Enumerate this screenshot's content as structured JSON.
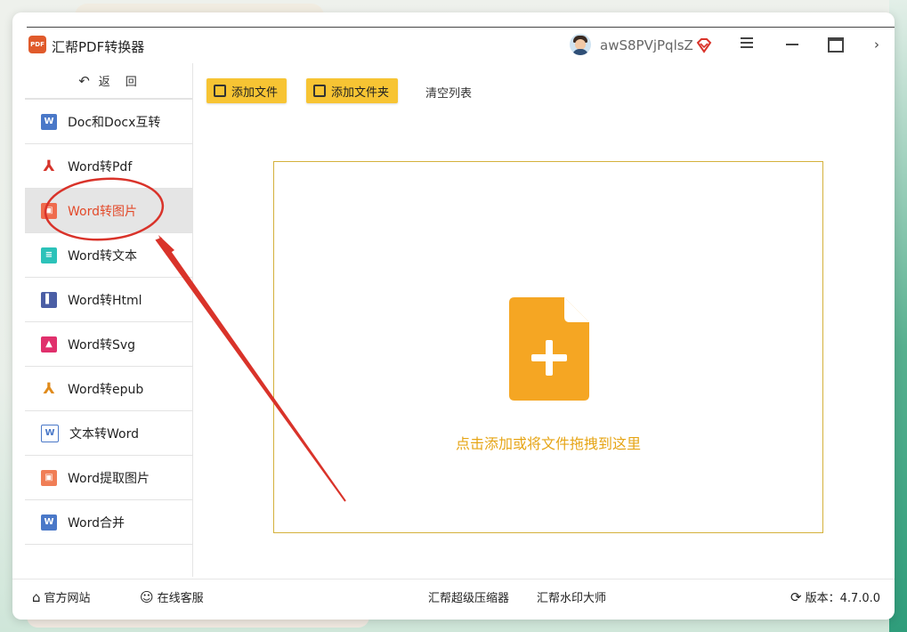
{
  "app": {
    "title": "汇帮PDF转换器",
    "logo_text": "PDF",
    "username": "awS8PVjPqlsZ"
  },
  "sidebar": {
    "back_label": "返　回",
    "items": [
      {
        "label": "Doc和Docx互转",
        "icon": "word-icon"
      },
      {
        "label": "Word转Pdf",
        "icon": "pdf-icon"
      },
      {
        "label": "Word转图片",
        "icon": "image-icon",
        "active": true
      },
      {
        "label": "Word转文本",
        "icon": "text-icon"
      },
      {
        "label": "Word转Html",
        "icon": "html-icon"
      },
      {
        "label": "Word转Svg",
        "icon": "svg-icon"
      },
      {
        "label": "Word转epub",
        "icon": "epub-icon"
      },
      {
        "label": "文本转Word",
        "icon": "word-icon"
      },
      {
        "label": "Word提取图片",
        "icon": "image-icon"
      },
      {
        "label": "Word合并",
        "icon": "word-icon"
      }
    ]
  },
  "toolbar": {
    "add_file": "添加文件",
    "add_folder": "添加文件夹",
    "clear_list": "清空列表"
  },
  "dropzone": {
    "text": "点击添加或将文件拖拽到这里"
  },
  "statusbar": {
    "website": "官方网站",
    "support": "在线客服",
    "compressor": "汇帮超级压缩器",
    "watermark": "汇帮水印大师",
    "version": "版本：4.7.0.0"
  },
  "colors": {
    "accent_yellow": "#f7c433",
    "active_red": "#e34a2a",
    "drop_orange": "#f5a623",
    "annotation_red": "#d9332a"
  }
}
